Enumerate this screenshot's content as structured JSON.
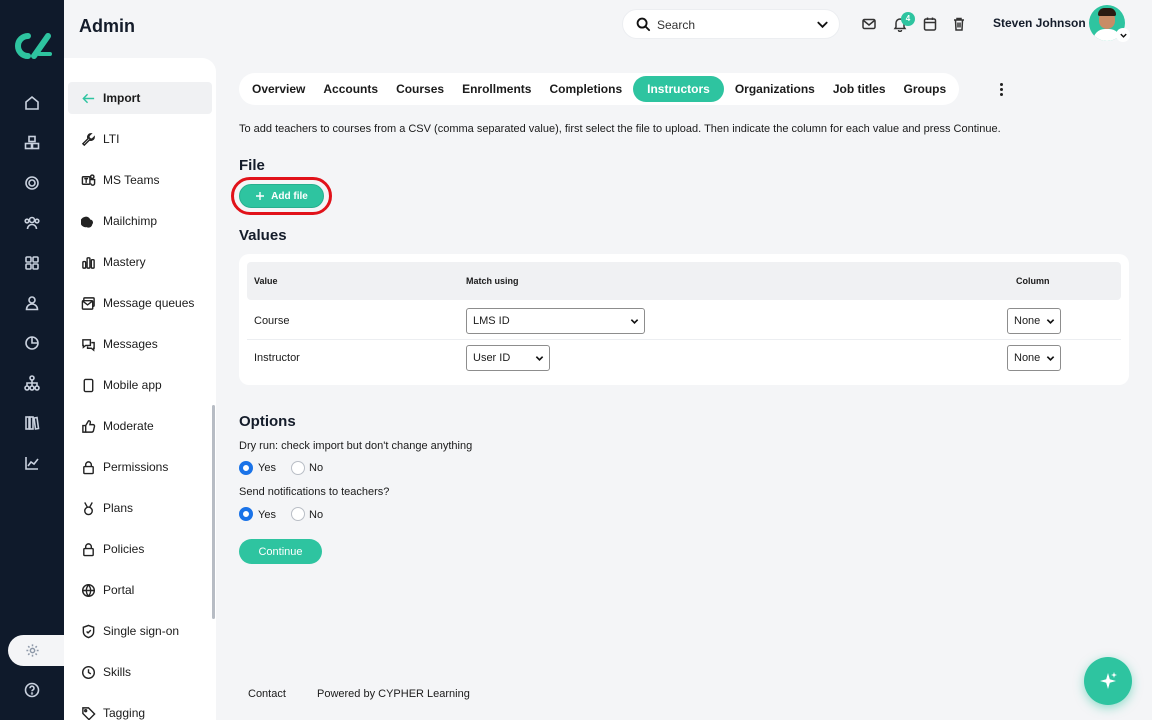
{
  "app": {
    "title": "Admin"
  },
  "header": {
    "search_label": "Search",
    "notification_count": "4",
    "user_name": "Steven Johnson"
  },
  "subnav": {
    "items": [
      {
        "label": "Import",
        "icon": "arrow-left-icon",
        "active": true
      },
      {
        "label": "LTI",
        "icon": "wrench-icon"
      },
      {
        "label": "MS Teams",
        "icon": "teams-icon"
      },
      {
        "label": "Mailchimp",
        "icon": "mailchimp-icon"
      },
      {
        "label": "Mastery",
        "icon": "bar-chart-icon"
      },
      {
        "label": "Message queues",
        "icon": "message-queue-icon"
      },
      {
        "label": "Messages",
        "icon": "chat-bubbles-icon"
      },
      {
        "label": "Mobile app",
        "icon": "mobile-icon"
      },
      {
        "label": "Moderate",
        "icon": "thumbs-up-icon"
      },
      {
        "label": "Permissions",
        "icon": "lock-icon"
      },
      {
        "label": "Plans",
        "icon": "medal-icon"
      },
      {
        "label": "Policies",
        "icon": "lock-icon"
      },
      {
        "label": "Portal",
        "icon": "globe-icon"
      },
      {
        "label": "Single sign-on",
        "icon": "shield-icon"
      },
      {
        "label": "Skills",
        "icon": "clock-icon"
      },
      {
        "label": "Tagging",
        "icon": "tag-icon"
      }
    ]
  },
  "tabs": [
    "Overview",
    "Accounts",
    "Courses",
    "Enrollments",
    "Completions",
    "Instructors",
    "Organizations",
    "Job titles",
    "Groups"
  ],
  "active_tab": "Instructors",
  "intro": "To add teachers to courses from a CSV (comma separated value), first select the file to upload. Then indicate the column for each value and press Continue.",
  "file": {
    "heading": "File",
    "add_button": "Add file"
  },
  "values": {
    "heading": "Values",
    "columns": {
      "value": "Value",
      "match": "Match using",
      "column": "Column"
    },
    "rows": [
      {
        "name": "Course",
        "match": "LMS ID",
        "column": "None"
      },
      {
        "name": "Instructor",
        "match": "User ID",
        "column": "None"
      }
    ]
  },
  "options": {
    "heading": "Options",
    "dry_run_question": "Dry run: check import but don't change anything",
    "notify_question": "Send notifications to teachers?",
    "yes": "Yes",
    "no": "No",
    "dry_run_selected": "Yes",
    "notify_selected": "Yes"
  },
  "continue_label": "Continue",
  "footer": {
    "contact": "Contact",
    "powered": "Powered by CYPHER Learning"
  },
  "colors": {
    "accent": "#2ec4a0",
    "rail": "#0f1a2b",
    "highlight_ring": "#e1121a",
    "radio": "#1a73e8"
  }
}
